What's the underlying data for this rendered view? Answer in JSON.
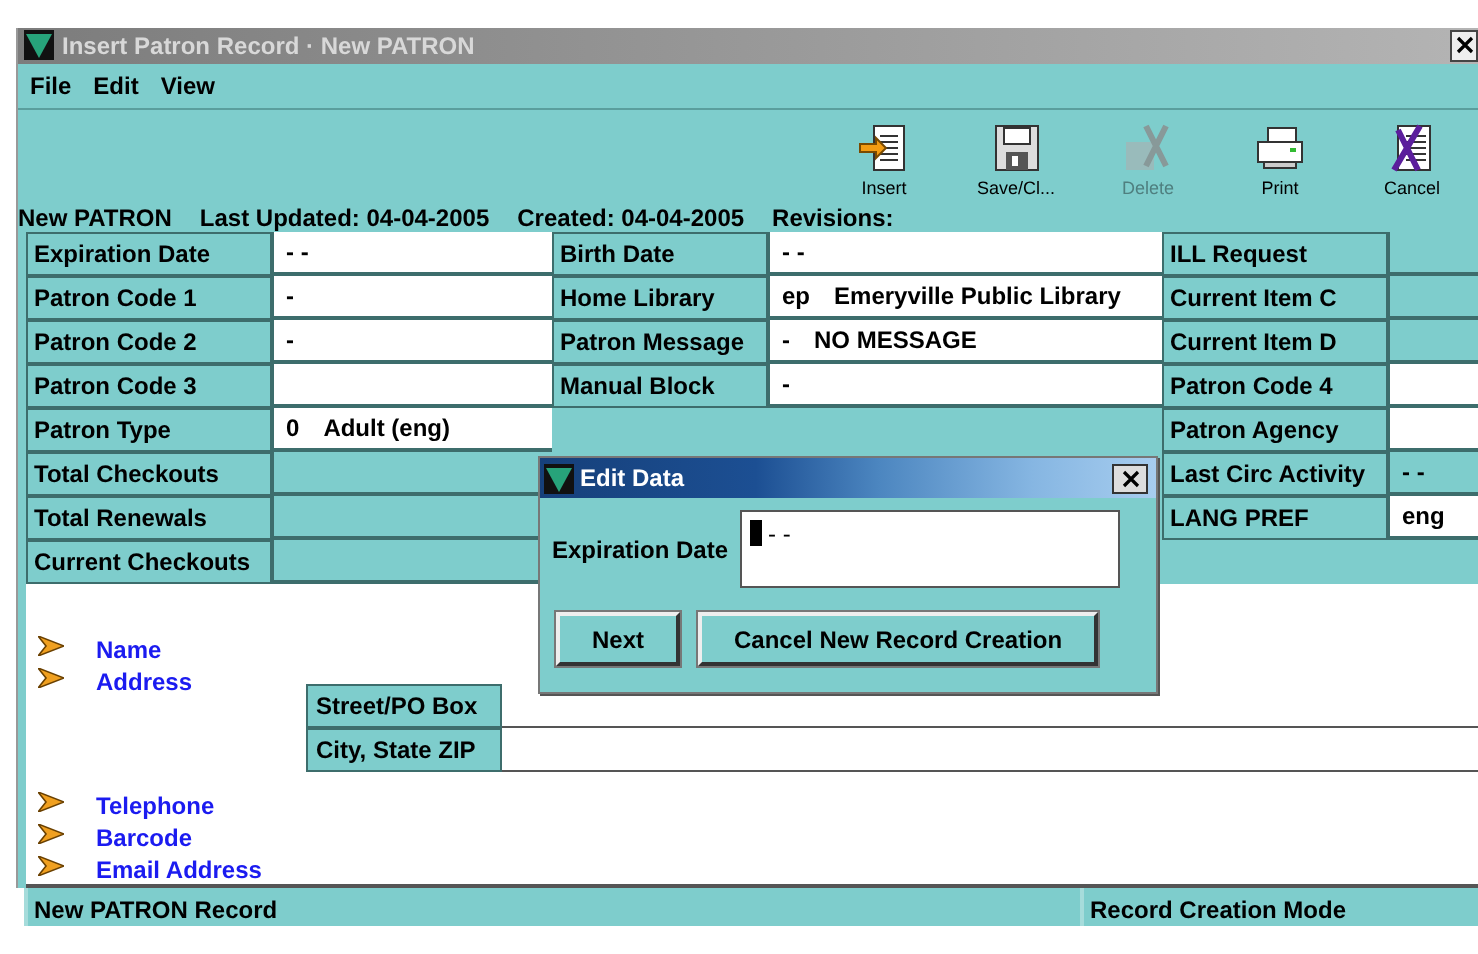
{
  "window": {
    "title": "Insert Patron Record · New PATRON"
  },
  "menu": [
    {
      "label": "File"
    },
    {
      "label": "Edit"
    },
    {
      "label": "View"
    }
  ],
  "toolbar": [
    {
      "kind": "insert",
      "label": "Insert",
      "disabled": false
    },
    {
      "kind": "save",
      "label": "Save/Cl...",
      "disabled": false
    },
    {
      "kind": "delete",
      "label": "Delete",
      "disabled": true
    },
    {
      "kind": "print",
      "label": "Print",
      "disabled": false
    },
    {
      "kind": "cancel",
      "label": "Cancel",
      "disabled": false
    }
  ],
  "header": [
    {
      "label": "New PATRON"
    },
    {
      "label": "Last Updated: 04-04-2005"
    },
    {
      "label": "Created: 04-04-2005"
    },
    {
      "label": "Revisions:"
    }
  ],
  "columns": [
    [
      {
        "label": "Expiration Date",
        "value": [
          "- -"
        ],
        "editable": true
      },
      {
        "label": "Patron Code 1",
        "value": [
          "-"
        ],
        "editable": true
      },
      {
        "label": "Patron Code 2",
        "value": [
          "-"
        ],
        "editable": true
      },
      {
        "label": "Patron Code 3",
        "editable": true
      },
      {
        "label": "Patron Type",
        "value": [
          "0",
          "Adult (eng)"
        ],
        "editable": true
      },
      {
        "label": "Total Checkouts",
        "editable": false
      },
      {
        "label": "Total Renewals",
        "editable": false
      },
      {
        "label": "Current Checkouts",
        "editable": false
      }
    ],
    [
      {
        "label": "Birth Date",
        "value": [
          "- -"
        ],
        "editable": true
      },
      {
        "label": "Home Library",
        "value": [
          "ep",
          "Emeryville Public Library"
        ],
        "editable": true
      },
      {
        "label": "Patron Message",
        "value": [
          "-",
          "NO MESSAGE"
        ],
        "editable": true
      },
      {
        "label": "Manual Block",
        "value": [
          "-"
        ],
        "editable": true
      }
    ],
    [
      {
        "label": "ILL Request",
        "editable": false
      },
      {
        "label": "Current Item C",
        "editable": false
      },
      {
        "label": "Current Item D",
        "editable": false
      },
      {
        "label": "Patron Code 4",
        "editable": true
      },
      {
        "label": "Patron Agency",
        "editable": true
      },
      {
        "label": "Last Circ Activity",
        "value": [
          "- -"
        ],
        "editable": false
      },
      {
        "label": "LANG PREF",
        "value": [
          "eng"
        ],
        "editable": true
      }
    ]
  ],
  "sections": [
    {
      "label": "Name",
      "kind": "plain"
    },
    {
      "label": "Address",
      "kind": "address",
      "fields": [
        {
          "label": "Street/PO Box"
        },
        {
          "label": "City, State ZIP"
        }
      ]
    },
    {
      "label": "Telephone",
      "kind": "plain"
    },
    {
      "label": "Barcode",
      "kind": "plain"
    },
    {
      "label": "Email Address",
      "kind": "plain"
    }
  ],
  "dialog": {
    "title": "Edit Data",
    "field_label": "Expiration Date",
    "value": "- -",
    "buttons": [
      {
        "label": "Next"
      },
      {
        "label": "Cancel New Record Creation"
      }
    ]
  },
  "status_bar": [
    {
      "label": "New PATRON Record"
    },
    {
      "label": "Record Creation Mode"
    }
  ]
}
